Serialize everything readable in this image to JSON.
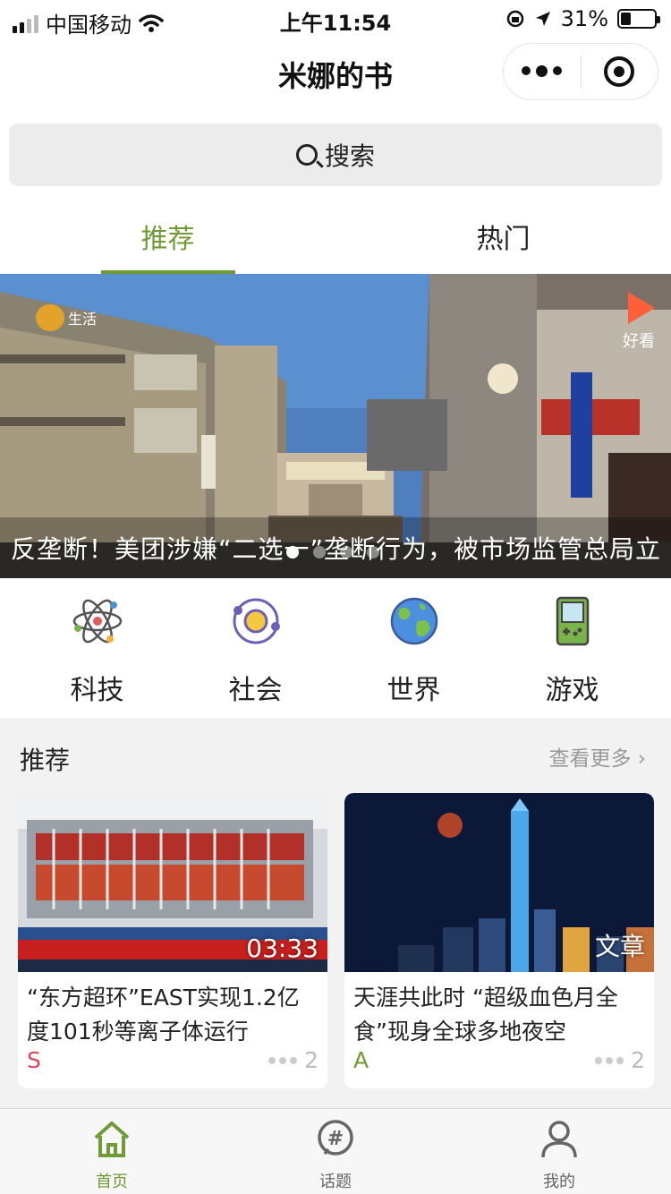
{
  "status_bar": {
    "carrier": "中国移动",
    "time": "上午11:54",
    "battery": "31%"
  },
  "nav": {
    "title": "米娜的书"
  },
  "search": {
    "label": "搜索"
  },
  "tabs": [
    {
      "label": "推荐",
      "active": true
    },
    {
      "label": "热门",
      "active": false
    }
  ],
  "banner": {
    "caption": "反垄断！美团涉嫌“二选一”垄断行为，被市场监管总局立",
    "watermark_left": "生活",
    "watermark_right": "好看",
    "slides": 4,
    "current_slide": 1
  },
  "categories": [
    {
      "label": "科技",
      "icon": "atom-icon"
    },
    {
      "label": "社会",
      "icon": "orbit-icon"
    },
    {
      "label": "世界",
      "icon": "globe-icon"
    },
    {
      "label": "游戏",
      "icon": "gameboy-icon"
    }
  ],
  "section": {
    "title": "推荐",
    "more": "查看更多"
  },
  "cards": [
    {
      "title": "“东方超环”EAST实现1.2亿度101秒等离子体运行",
      "badge": "03:33",
      "author": "S",
      "author_color": "#e0445a",
      "count": "2"
    },
    {
      "title": "天涯共此时 “超级血色月全食”现身全球多地夜空",
      "badge": "文章",
      "author": "A",
      "author_color": "#6f9a35",
      "count": "2"
    }
  ],
  "tabbar": [
    {
      "label": "首页",
      "icon": "home-icon",
      "active": true
    },
    {
      "label": "话题",
      "icon": "hashtag-icon",
      "active": false
    },
    {
      "label": "我的",
      "icon": "user-icon",
      "active": false
    }
  ],
  "colors": {
    "accent": "#6f9a35",
    "background": "#f2f2f2"
  }
}
